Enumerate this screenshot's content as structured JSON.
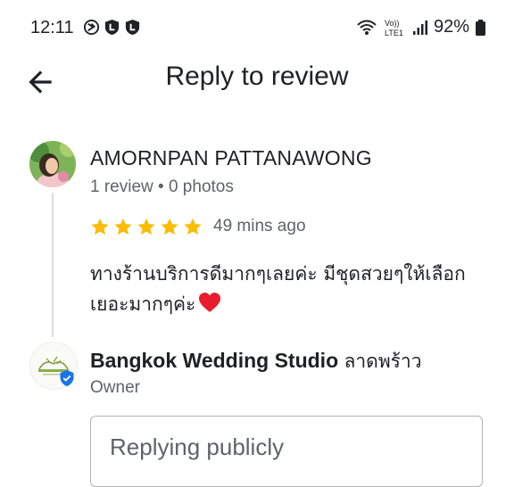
{
  "status_bar": {
    "time": "12:11",
    "battery": "92%",
    "icons": [
      "nfc-icon",
      "notification-l-icon",
      "notification-l-icon",
      "wifi-icon",
      "volte-icon",
      "signal-icon",
      "battery-icon"
    ],
    "volte_label_top": "Vo))",
    "volte_label_bottom": "LTE1"
  },
  "header": {
    "title": "Reply to review",
    "back_icon": "arrow-back-icon"
  },
  "review": {
    "reviewer_name": "AMORNPAN PATTANAWONG",
    "meta": "1 review • 0 photos",
    "rating": 5,
    "time": "49 mins ago",
    "text": "ทางร้านบริการดีมากๆเลยค่ะ มีชุดสวยๆให้เลือกเยอะมากๆค่ะ",
    "emoji": "red-heart-icon",
    "star_color": "#fbbc04"
  },
  "owner": {
    "name_bold": "Bangkok Wedding Studio",
    "name_thai": "ลาดพร้าว",
    "role": "Owner",
    "badge_color": "#1a73e8"
  },
  "reply": {
    "placeholder": "Replying publicly"
  }
}
